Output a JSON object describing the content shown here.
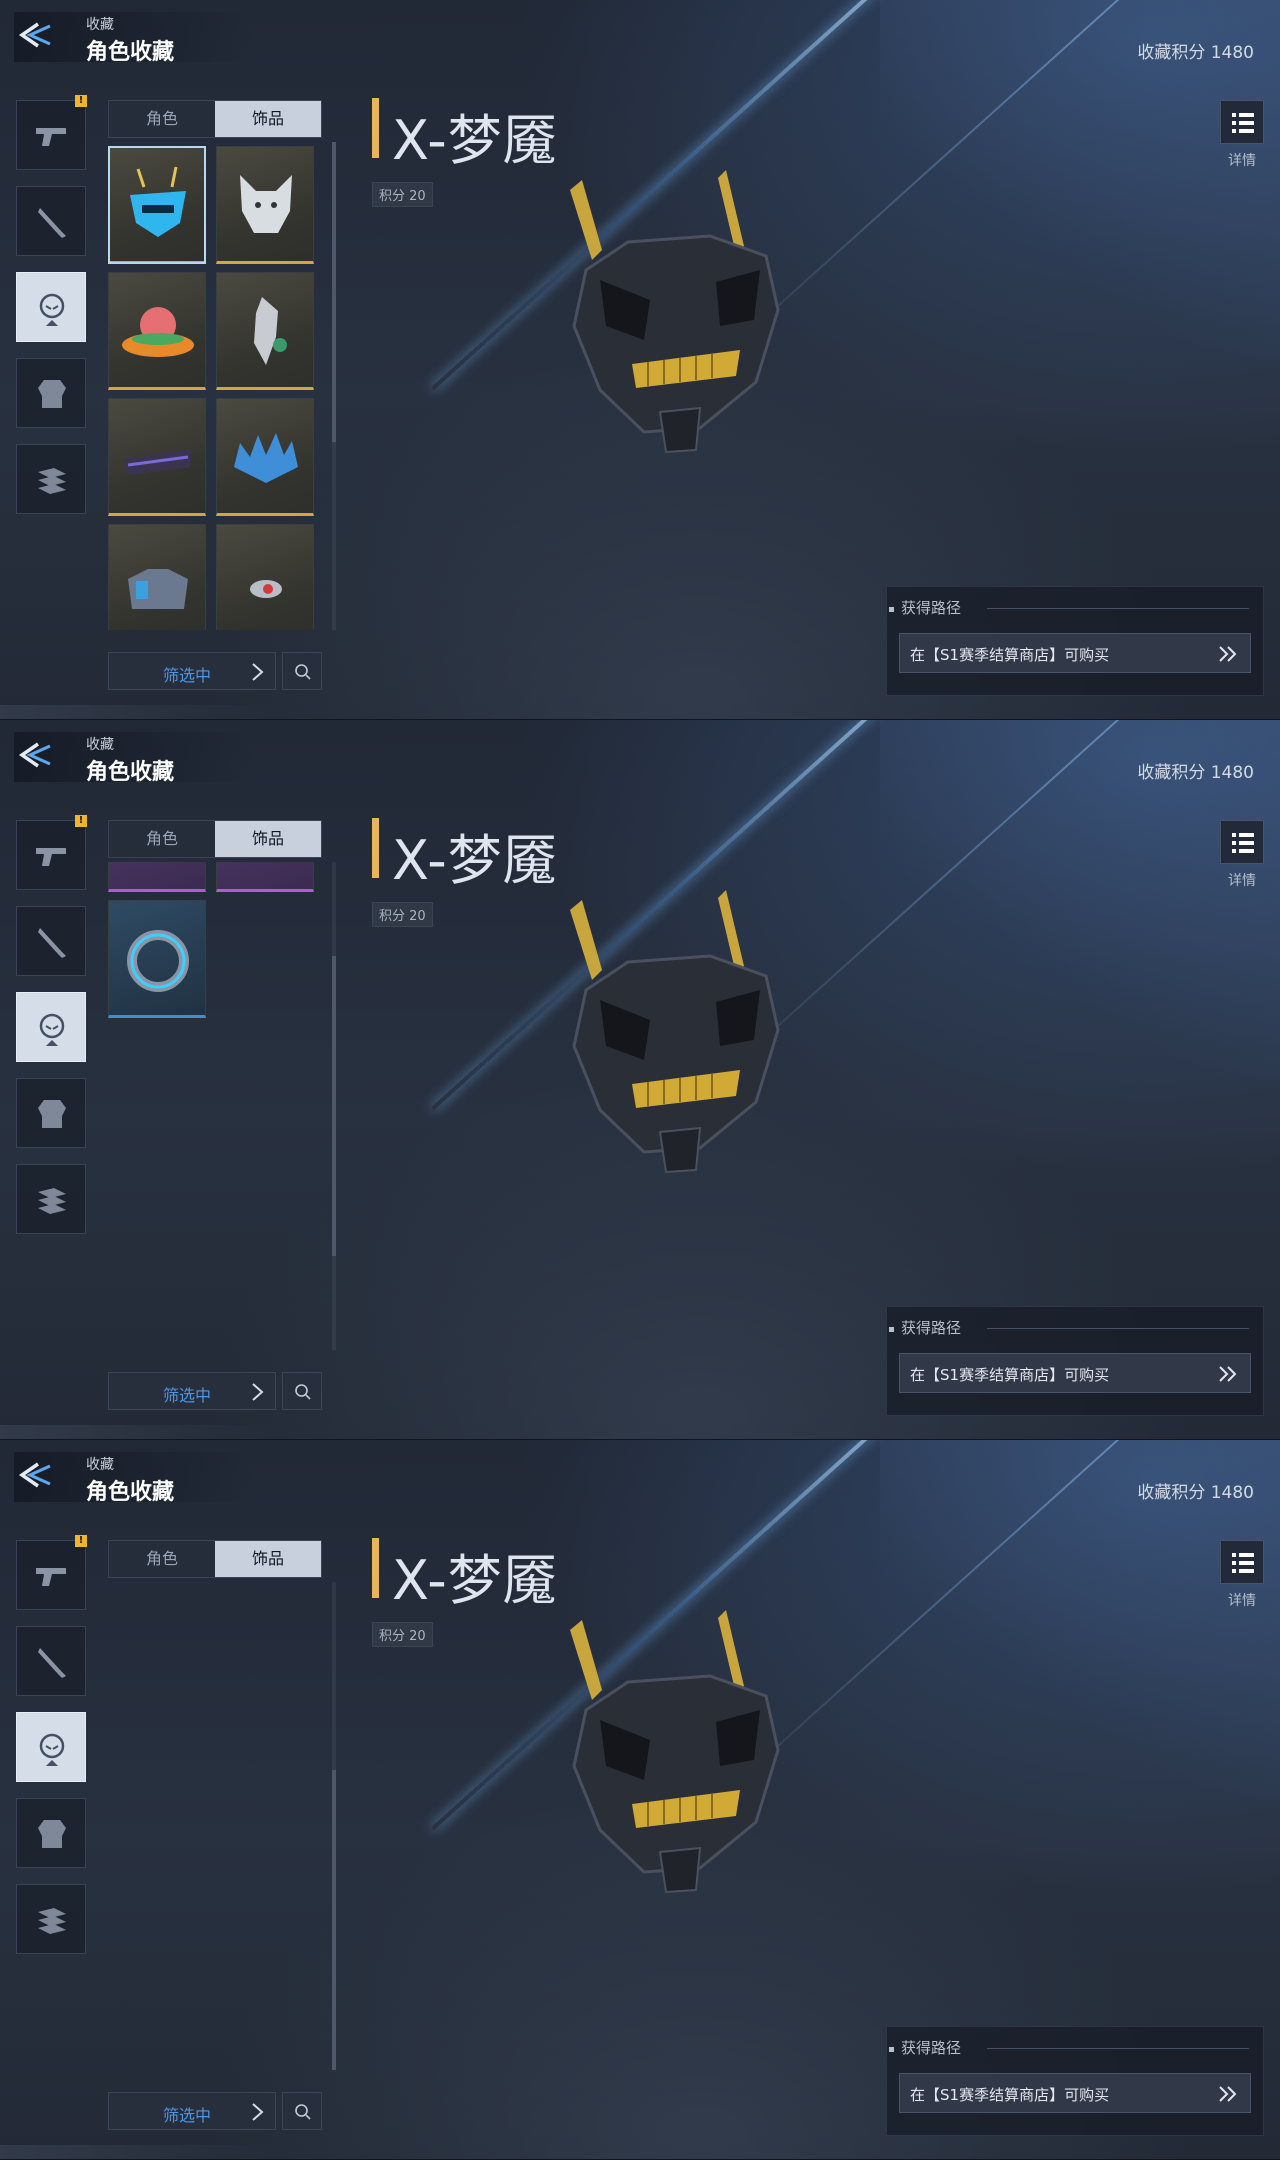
{
  "screens": [
    {
      "header": {
        "crumb": "收藏",
        "title": "角色收藏",
        "points_label": "收藏积分 1480"
      },
      "tabs": [
        {
          "label": "角色",
          "active": false
        },
        {
          "label": "饰品",
          "active": true
        }
      ],
      "grid_first_row": 0,
      "scroll_position": 0.0,
      "rail_active": 2,
      "item": {
        "name": "X-梦魇",
        "points": "积分 20"
      },
      "detail_label": "详情",
      "filter_label": "筛选中",
      "source": {
        "title": "获得路径",
        "text": "在【S1赛季结算商店】可购买"
      }
    },
    {
      "header": {
        "crumb": "收藏",
        "title": "角色收藏",
        "points_label": "收藏积分 1480"
      },
      "tabs": [
        {
          "label": "角色",
          "active": false
        },
        {
          "label": "饰品",
          "active": true
        }
      ],
      "grid_first_row": 3,
      "scroll_position": 0.5,
      "rail_active": 2,
      "item": {
        "name": "X-梦魇",
        "points": "积分 20"
      },
      "detail_label": "详情",
      "filter_label": "筛选中",
      "source": {
        "title": "获得路径",
        "text": "在【S1赛季结算商店】可购买"
      }
    },
    {
      "header": {
        "crumb": "收藏",
        "title": "角色收藏",
        "points_label": "收藏积分 1480"
      },
      "tabs": [
        {
          "label": "角色",
          "active": false
        },
        {
          "label": "饰品",
          "active": true
        }
      ],
      "grid_first_row": 4,
      "scroll_position": 1.0,
      "rail_active": 2,
      "item": {
        "name": "X-梦魇",
        "points": "积分 20"
      },
      "detail_label": "详情",
      "filter_label": "筛选中",
      "source": {
        "title": "获得路径",
        "text": "在【S1赛季结算商店】可购买"
      }
    }
  ],
  "rail": [
    {
      "icon": "pistol-icon",
      "alert": "!"
    },
    {
      "icon": "knife-icon",
      "alert": ""
    },
    {
      "icon": "character-head-icon",
      "alert": ""
    },
    {
      "icon": "armor-icon",
      "alert": ""
    },
    {
      "icon": "stacked-cards-icon",
      "alert": ""
    }
  ],
  "grid_items": [
    {
      "icon": "cyber-mask-icon",
      "rarity": "gold",
      "color": "#3fc6ff"
    },
    {
      "icon": "wolf-head-icon",
      "rarity": "gold",
      "color": "#d8dde2"
    },
    {
      "icon": "pig-hat-icon",
      "rarity": "gold",
      "color": "#e66f74"
    },
    {
      "icon": "robot-bird-icon",
      "rarity": "gold",
      "color": "#c8ccd2"
    },
    {
      "icon": "visor-icon",
      "rarity": "gold",
      "color": "#5a4a9a"
    },
    {
      "icon": "ice-crown-icon",
      "rarity": "gold",
      "color": "#3e8fd8"
    },
    {
      "icon": "armor-rig-icon",
      "rarity": "gold",
      "color": "#8aa0b8"
    },
    {
      "icon": "red-eye-drone-icon",
      "rarity": "gold",
      "color": "#d23a3a"
    },
    {
      "icon": "winged-helmet-icon",
      "rarity": "purple",
      "color": "#b0a070"
    },
    {
      "icon": "sunglasses-icon",
      "rarity": "purple",
      "color": "#7a5aff"
    },
    {
      "icon": "horned-band-icon",
      "rarity": "purple",
      "color": "#e05a7a"
    },
    {
      "icon": "face-mask-icon",
      "rarity": "purple",
      "color": "#ff7a9a"
    },
    {
      "icon": "ring-band-icon",
      "rarity": "blue",
      "color": "#3cd0ff"
    }
  ]
}
